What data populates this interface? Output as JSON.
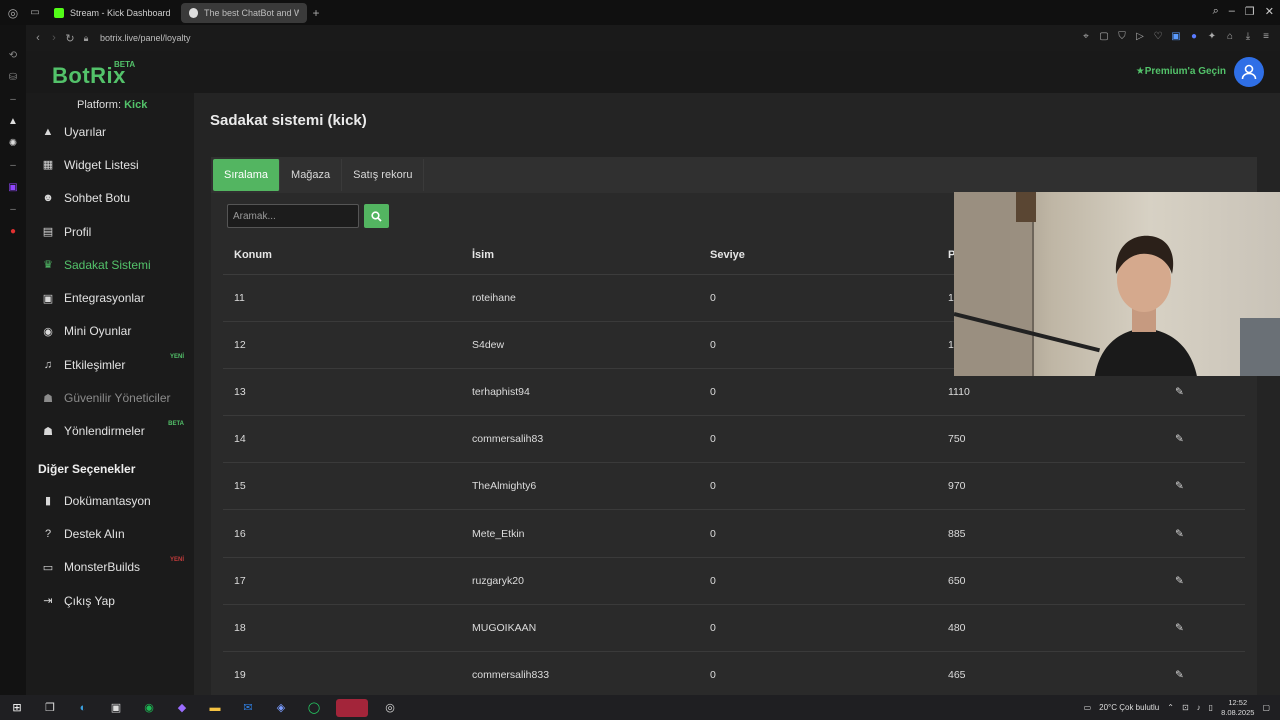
{
  "browser": {
    "tabs": [
      {
        "title": "Stream - Kick Dashboard",
        "color": "#53fc18"
      },
      {
        "title": "The best ChatBot and Wi",
        "color": "#dddddd"
      }
    ],
    "url": "botrix.live/panel/loyalty"
  },
  "header": {
    "logo": "BotRix",
    "beta": "BETA",
    "premium": "★Premium'a Geçin"
  },
  "sidebar": {
    "platform_label": "Platform:",
    "platform_value": "Kick",
    "items": [
      {
        "label": "Uyarılar",
        "icon": "warning-icon"
      },
      {
        "label": "Widget Listesi",
        "icon": "grid-icon"
      },
      {
        "label": "Sohbet Botu",
        "icon": "robot-icon"
      },
      {
        "label": "Profil",
        "icon": "id-card-icon"
      },
      {
        "label": "Sadakat Sistemi",
        "icon": "trophy-icon"
      },
      {
        "label": "Entegrasyonlar",
        "icon": "plug-icon"
      },
      {
        "label": "Mini Oyunlar",
        "icon": "gamepad-icon"
      },
      {
        "label": "Etkileşimler",
        "icon": "music-icon",
        "tag": "YENİ"
      },
      {
        "label": "Güvenilir Yöneticiler",
        "icon": "users-icon"
      },
      {
        "label": "Yönlendirmeler",
        "icon": "users-icon",
        "tag": "BETA"
      }
    ],
    "section": "Diğer Seçenekler",
    "other": [
      {
        "label": "Dokümantasyon",
        "icon": "book-icon"
      },
      {
        "label": "Destek Alın",
        "icon": "help-icon"
      },
      {
        "label": "MonsterBuilds",
        "icon": "laptop-icon",
        "tag": "YENİ"
      },
      {
        "label": "Çıkış Yap",
        "icon": "logout-icon"
      }
    ]
  },
  "main": {
    "title": "Sadakat sistemi (kick)",
    "tabs": [
      "Sıralama",
      "Mağaza",
      "Satış rekoru"
    ],
    "search_placeholder": "Aramak...",
    "columns": [
      "Konum",
      "İsim",
      "Seviye",
      "P"
    ],
    "rows": [
      {
        "pos": "11",
        "name": "roteihane",
        "level": "0",
        "points": "1"
      },
      {
        "pos": "12",
        "name": "S4dew",
        "level": "0",
        "points": "1"
      },
      {
        "pos": "13",
        "name": "terhaphist94",
        "level": "0",
        "points": "1110"
      },
      {
        "pos": "14",
        "name": "commersalih83",
        "level": "0",
        "points": "750"
      },
      {
        "pos": "15",
        "name": "TheAlmighty6",
        "level": "0",
        "points": "970"
      },
      {
        "pos": "16",
        "name": "Mete_Etkin",
        "level": "0",
        "points": "885"
      },
      {
        "pos": "17",
        "name": "ruzgaryk20",
        "level": "0",
        "points": "650"
      },
      {
        "pos": "18",
        "name": "MUGOIKAAN",
        "level": "0",
        "points": "480"
      },
      {
        "pos": "19",
        "name": "commersalih833",
        "level": "0",
        "points": "465"
      }
    ]
  },
  "taskbar": {
    "weather": "20°C  Çok bulutlu",
    "time": "12:52",
    "date": "8.08.2025"
  },
  "colors": {
    "accent": "#53b561",
    "brand": "#53c26a"
  }
}
